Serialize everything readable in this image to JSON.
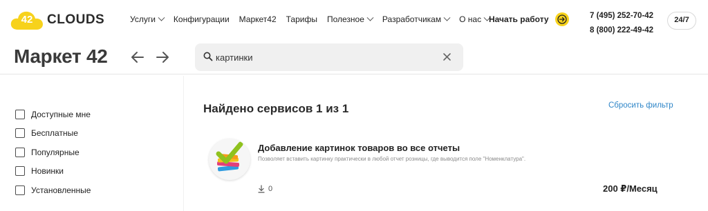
{
  "brand": {
    "logo_number": "42",
    "logo_text": "CLOUDS",
    "accent_color": "#f7d21c",
    "link_color": "#2f86c8"
  },
  "nav": {
    "items": [
      {
        "label": "Услуги",
        "has_dropdown": true
      },
      {
        "label": "Конфигурации",
        "has_dropdown": false
      },
      {
        "label": "Маркет42",
        "has_dropdown": false
      },
      {
        "label": "Тарифы",
        "has_dropdown": false
      },
      {
        "label": "Полезное",
        "has_dropdown": true
      },
      {
        "label": "Разработчикам",
        "has_dropdown": true
      },
      {
        "label": "О нас",
        "has_dropdown": true
      }
    ],
    "start_work_label": "Начать работу"
  },
  "contacts": {
    "phone1": "7 (495) 252-70-42",
    "phone2": "8 (800) 222-49-42",
    "support_badge": "24/7"
  },
  "page": {
    "title": "Маркет 42",
    "search": {
      "value": "картинки",
      "placeholder": ""
    }
  },
  "filters": [
    {
      "label": "Доступные мне",
      "checked": false
    },
    {
      "label": "Бесплатные",
      "checked": false
    },
    {
      "label": "Популярные",
      "checked": false
    },
    {
      "label": "Новинки",
      "checked": false
    },
    {
      "label": "Установленные",
      "checked": false
    }
  ],
  "results": {
    "heading": "Найдено сервисов 1 из 1",
    "reset_label": "Сбросить фильтр",
    "services": [
      {
        "title": "Добавление картинок товаров во все отчеты",
        "description": "Позволяет вставить картинку практически в любой отчет розницы, где выводится поле \"Номенклатура\".",
        "downloads": "0",
        "price": "200 ₽/Месяц",
        "icon": "stacked-pictures-checkmark-icon"
      }
    ]
  }
}
